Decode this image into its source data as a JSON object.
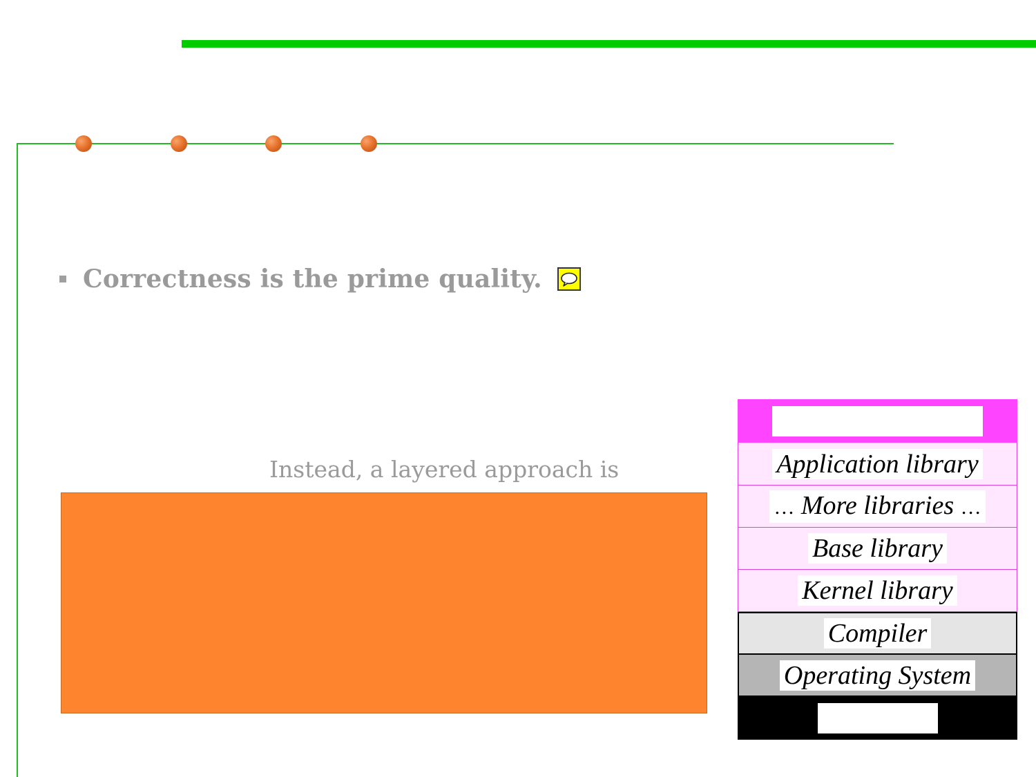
{
  "slide": {
    "bullet": "Correctness is the prime quality.",
    "comment_icon": "speech-bubble-icon",
    "partial_text": "Instead, a layered approach is"
  },
  "layer_stack": {
    "layers": [
      {
        "label": ""
      },
      {
        "label": "Application library"
      },
      {
        "label": "More libraries",
        "prefix": "…",
        "suffix": "…"
      },
      {
        "label": "Base library"
      },
      {
        "label": "Kernel library"
      },
      {
        "label": "Compiler"
      },
      {
        "label": "Operating System"
      },
      {
        "label": ""
      }
    ]
  },
  "colors": {
    "accent_green": "#00cc00",
    "frame_green": "#22bb22",
    "dot_orange": "#e8732d",
    "box_orange": "#fe842e",
    "library_pink": "#ff44ff",
    "library_light": "#ffe8ff",
    "compiler_gray": "#e5e5e5",
    "os_gray": "#b5b5b5",
    "comment_yellow": "#ffff00"
  }
}
